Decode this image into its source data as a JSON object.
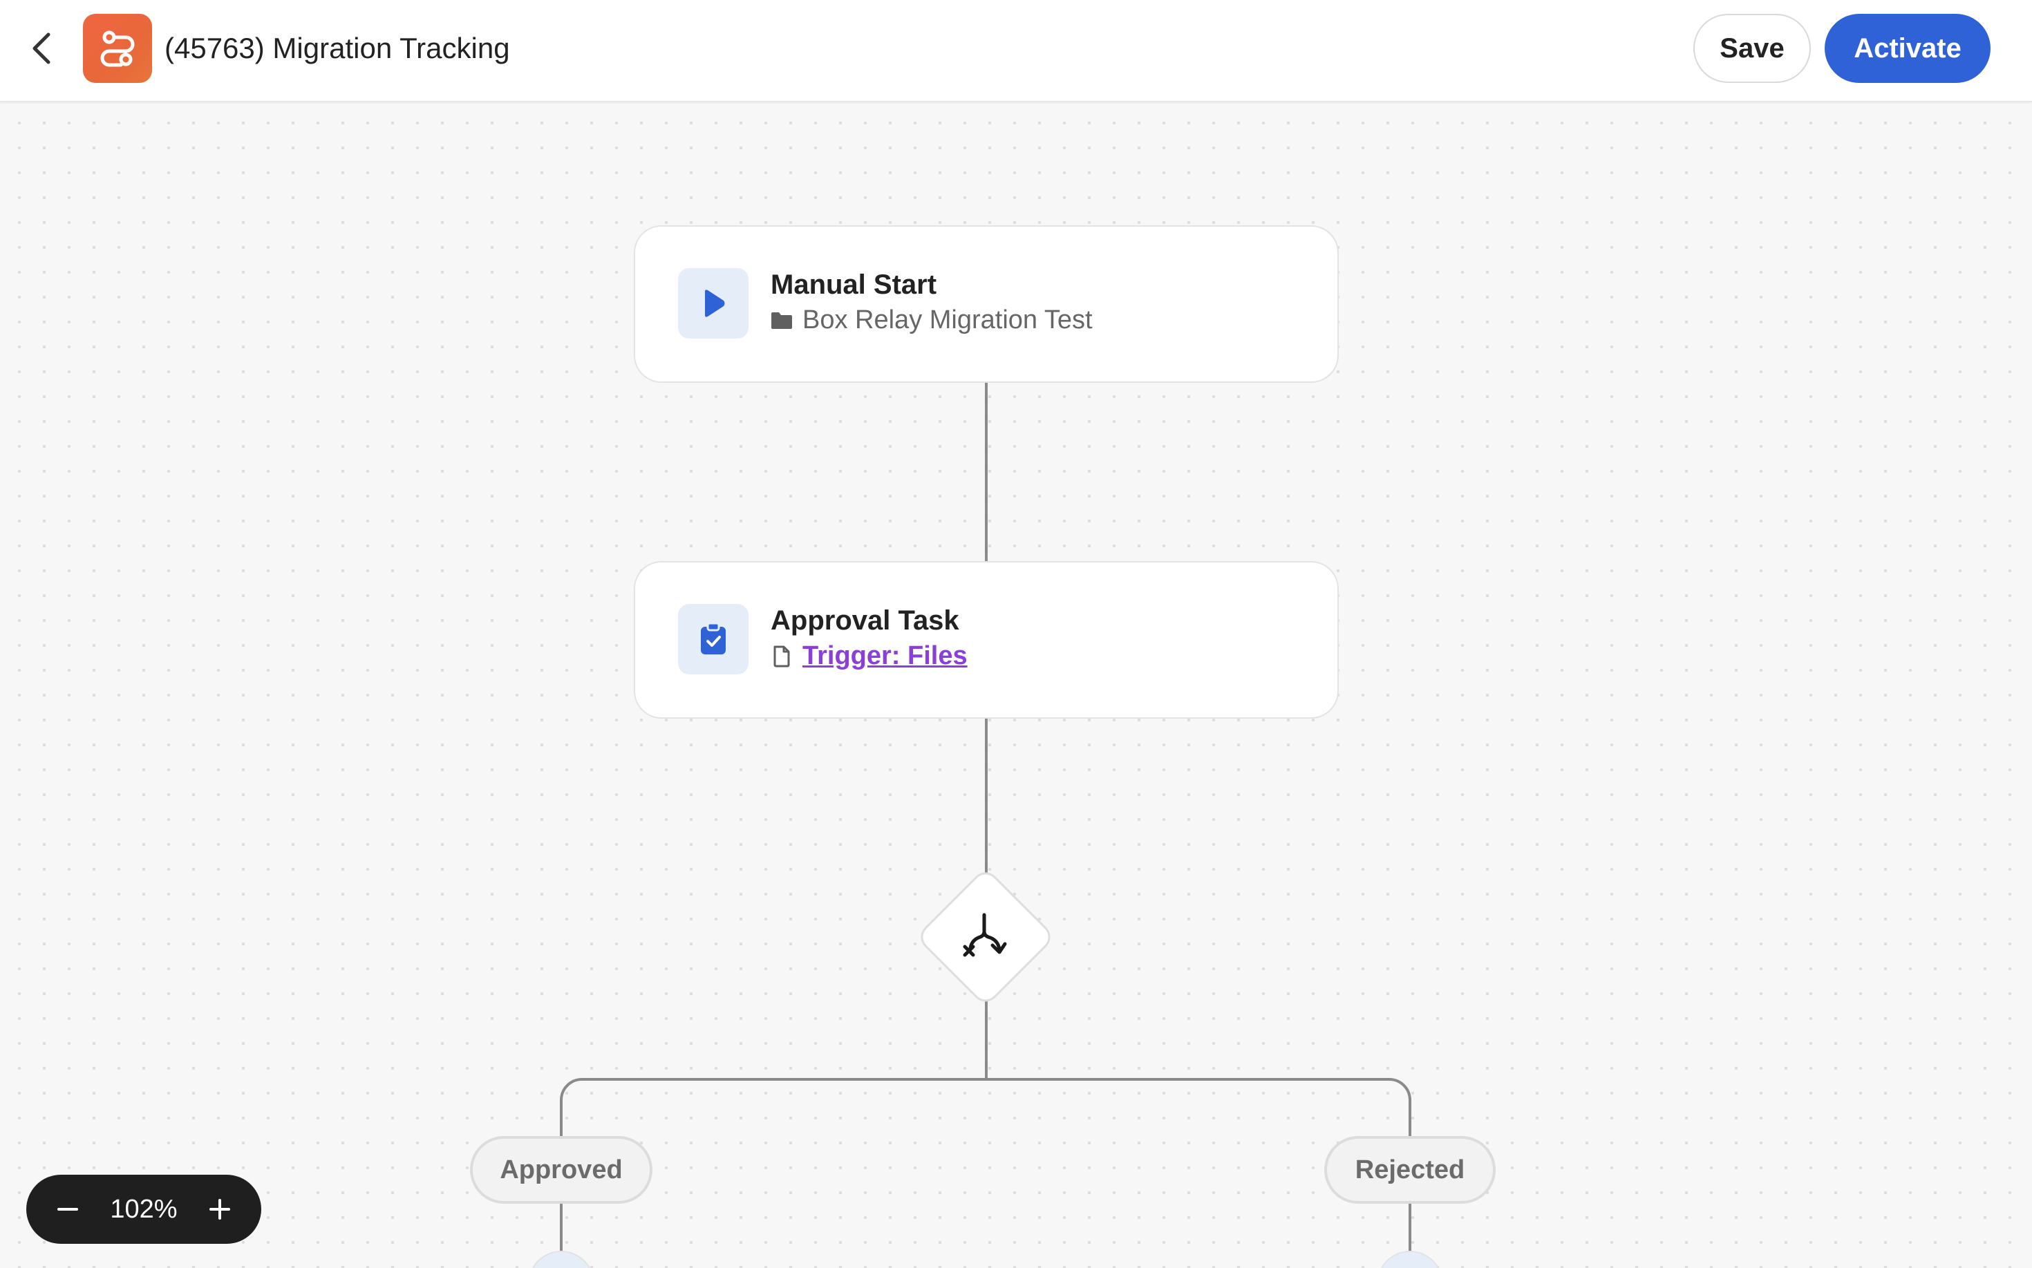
{
  "header": {
    "title": "(45763) Migration Tracking",
    "save_label": "Save",
    "activate_label": "Activate"
  },
  "nodes": [
    {
      "title": "Manual Start",
      "subtitle": "Box Relay Migration Test",
      "icon": "play-icon",
      "subtitle_icon": "folder-icon"
    },
    {
      "title": "Approval Task",
      "subtitle": "Trigger: Files",
      "icon": "clipboard-check-icon",
      "subtitle_icon": "file-icon"
    }
  ],
  "decision": {
    "icon": "branch-split-icon"
  },
  "branches": [
    {
      "label": "Approved"
    },
    {
      "label": "Rejected"
    }
  ],
  "zoom": {
    "value": "102%",
    "zoom_out_icon": "minus-icon",
    "zoom_in_icon": "plus-icon"
  },
  "colors": {
    "accent": "#2e62d6",
    "brand": "#e8683a",
    "link": "#8a3fd9",
    "canvas": "#f7f7f7",
    "icon_bg": "#e5edf9"
  }
}
